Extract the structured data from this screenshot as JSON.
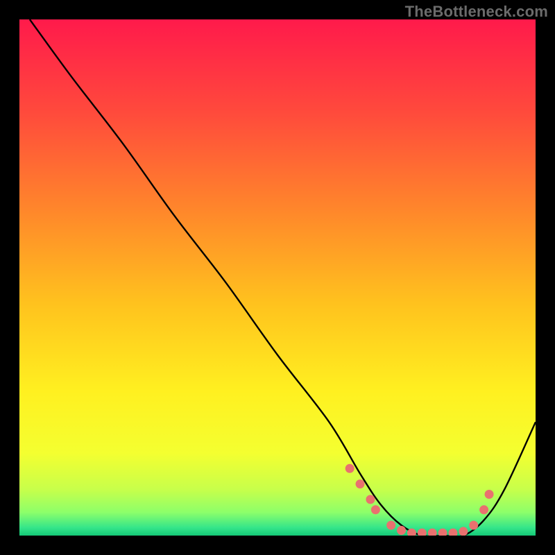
{
  "watermark": "TheBottleneck.com",
  "chart_data": {
    "type": "line",
    "title": "",
    "xlabel": "",
    "ylabel": "",
    "xlim": [
      0,
      100
    ],
    "ylim": [
      0,
      100
    ],
    "grid": false,
    "legend": false,
    "series": [
      {
        "name": "curve",
        "x": [
          2,
          10,
          20,
          30,
          40,
          50,
          60,
          66,
          70,
          74,
          78,
          82,
          86,
          90,
          94,
          100
        ],
        "y": [
          100,
          89,
          76,
          62,
          49,
          35,
          22,
          12,
          6,
          2,
          0,
          0,
          0,
          3,
          9,
          22
        ]
      }
    ],
    "markers": {
      "name": "dots",
      "x": [
        64,
        66,
        68,
        69,
        72,
        74,
        76,
        78,
        80,
        82,
        84,
        86,
        88,
        90,
        91
      ],
      "y": [
        13,
        10,
        7,
        5,
        2,
        1,
        0.5,
        0.5,
        0.5,
        0.5,
        0.5,
        0.8,
        2,
        5,
        8
      ]
    },
    "gradient_stops": [
      {
        "offset": 0.0,
        "color": "#ff1a4b"
      },
      {
        "offset": 0.18,
        "color": "#ff4a3c"
      },
      {
        "offset": 0.38,
        "color": "#ff8a2a"
      },
      {
        "offset": 0.55,
        "color": "#ffc21e"
      },
      {
        "offset": 0.72,
        "color": "#fff020"
      },
      {
        "offset": 0.84,
        "color": "#f4ff30"
      },
      {
        "offset": 0.91,
        "color": "#c8ff4a"
      },
      {
        "offset": 0.955,
        "color": "#8dff6a"
      },
      {
        "offset": 0.985,
        "color": "#34e58a"
      },
      {
        "offset": 1.0,
        "color": "#14c877"
      }
    ],
    "marker_color": "#e9716f",
    "line_color": "#000000"
  }
}
